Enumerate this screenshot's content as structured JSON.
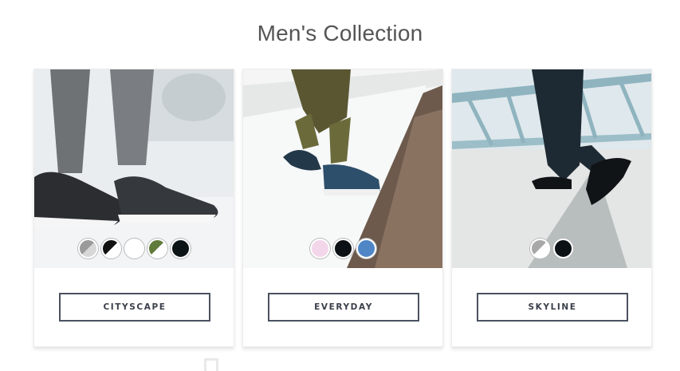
{
  "page": {
    "title": "Men's Collection"
  },
  "products": [
    {
      "name": "CITYSCAPE",
      "swatches": [
        {
          "label": "grey",
          "colors": [
            "#9a9a9a",
            "#d7d7d7"
          ]
        },
        {
          "label": "black-white",
          "colors": [
            "#111111",
            "#ffffff"
          ]
        },
        {
          "label": "white",
          "colors": [
            "#ffffff",
            "#ffffff"
          ]
        },
        {
          "label": "olive-white",
          "colors": [
            "#5f7a3a",
            "#ffffff"
          ]
        },
        {
          "label": "black",
          "colors": [
            "#0d1416",
            "#0d1416"
          ]
        }
      ]
    },
    {
      "name": "EVERYDAY",
      "swatches": [
        {
          "label": "pink",
          "colors": [
            "#f3d6ea",
            "#f3d6ea"
          ]
        },
        {
          "label": "black",
          "colors": [
            "#0b1114",
            "#0b1114"
          ]
        },
        {
          "label": "blue",
          "colors": [
            "#4f86c6",
            "#4f86c6"
          ]
        }
      ]
    },
    {
      "name": "SKYLINE",
      "swatches": [
        {
          "label": "grey-white",
          "colors": [
            "#a8a8a8",
            "#ffffff"
          ]
        },
        {
          "label": "black",
          "colors": [
            "#0b1114",
            "#0b1114"
          ]
        }
      ]
    }
  ]
}
